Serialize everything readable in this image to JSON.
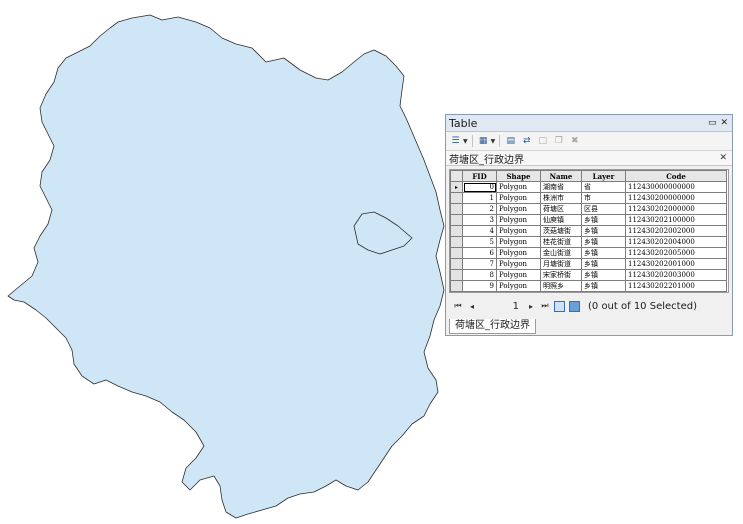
{
  "map": {
    "fill_color": "#cfe6f6",
    "stroke_color": "#2b2b2b"
  },
  "table_window": {
    "title": "Table",
    "pin_icon": "pin-icon",
    "close_icon": "close-icon",
    "toolbar_icons": [
      "table-options-icon",
      "related-tables-icon",
      "select-by-attributes-icon",
      "switch-selection-icon",
      "clear-selection-icon",
      "copy-selected-icon",
      "delete-selected-icon"
    ],
    "layer_tab_label": "荷塘区_行政边界",
    "columns": [
      "FID",
      "Shape",
      "Name",
      "Layer",
      "Code"
    ],
    "rows": [
      {
        "fid": "0",
        "shape": "Polygon",
        "name": "湖南省",
        "layer": "省",
        "code": "112430000000000"
      },
      {
        "fid": "1",
        "shape": "Polygon",
        "name": "株洲市",
        "layer": "市",
        "code": "112430200000000"
      },
      {
        "fid": "2",
        "shape": "Polygon",
        "name": "荷塘区",
        "layer": "区县",
        "code": "112430202000000"
      },
      {
        "fid": "3",
        "shape": "Polygon",
        "name": "仙庾镇",
        "layer": "乡镇",
        "code": "112430202100000"
      },
      {
        "fid": "4",
        "shape": "Polygon",
        "name": "茨菇塘街",
        "layer": "乡镇",
        "code": "112430202002000"
      },
      {
        "fid": "5",
        "shape": "Polygon",
        "name": "桂花街道",
        "layer": "乡镇",
        "code": "112430202004000"
      },
      {
        "fid": "6",
        "shape": "Polygon",
        "name": "金山街道",
        "layer": "乡镇",
        "code": "112430202005000"
      },
      {
        "fid": "7",
        "shape": "Polygon",
        "name": "月塘街道",
        "layer": "乡镇",
        "code": "112430202001000"
      },
      {
        "fid": "8",
        "shape": "Polygon",
        "name": "宋家桥街",
        "layer": "乡镇",
        "code": "112430202003000"
      },
      {
        "fid": "9",
        "shape": "Polygon",
        "name": "明照乡",
        "layer": "乡镇",
        "code": "112430202201000"
      }
    ],
    "current_row_marker": "▸",
    "nav": {
      "page": "1",
      "selection_status": "(0 out of 10 Selected)"
    },
    "bottom_tab_label": "荷塘区_行政边界"
  }
}
